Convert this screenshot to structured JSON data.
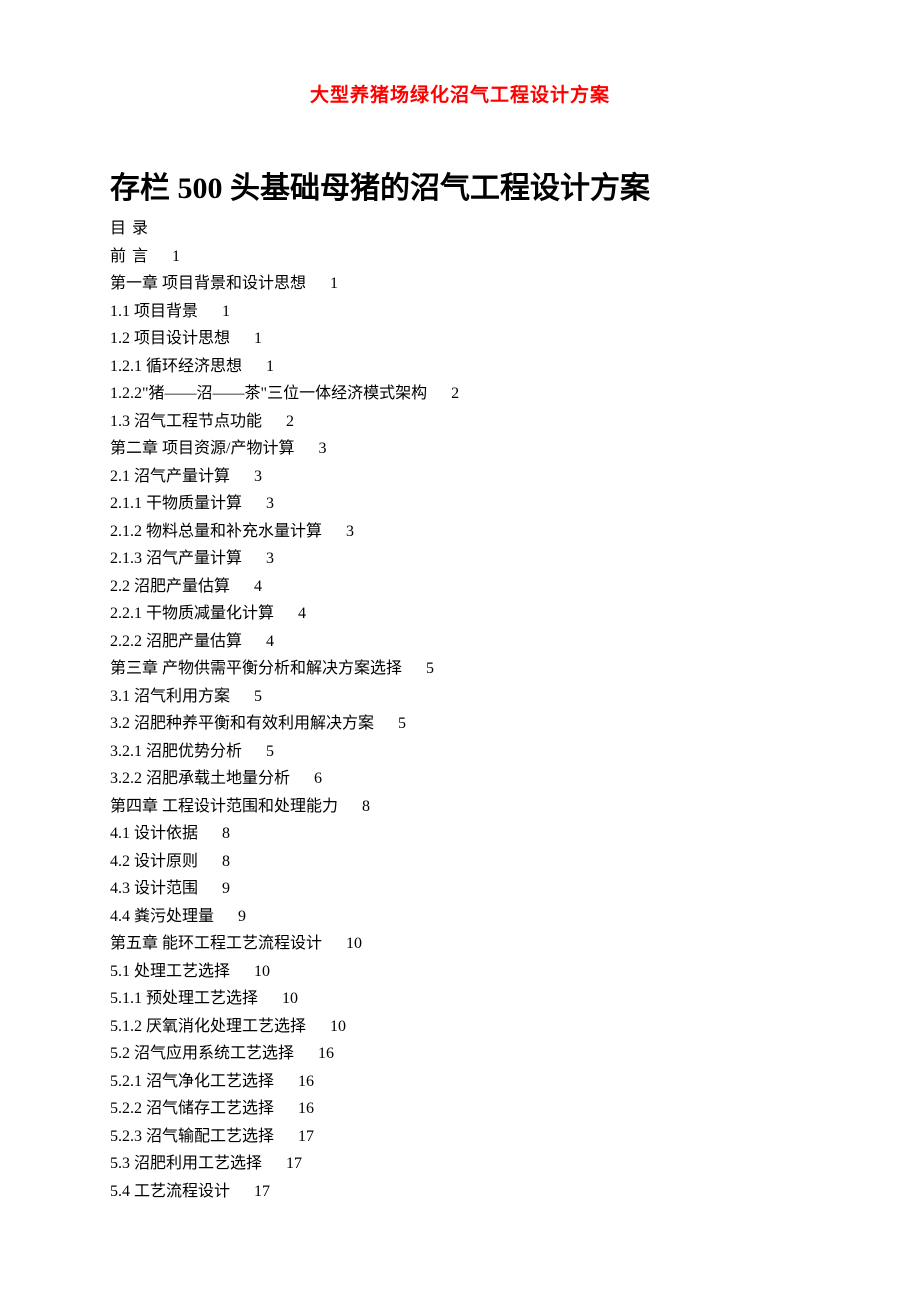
{
  "header_title": "大型养猪场绿化沼气工程设计方案",
  "main_title": "存栏 500 头基础母猪的沼气工程设计方案",
  "toc_header_mu": "目",
  "toc_header_lu": "录",
  "toc": [
    {
      "label_pre": "前",
      "label_post": "言",
      "page": "1",
      "spaced": true
    },
    {
      "label": "第一章 项目背景和设计思想",
      "page": "1"
    },
    {
      "label": "1.1 项目背景",
      "page": "1"
    },
    {
      "label": "1.2 项目设计思想",
      "page": "1"
    },
    {
      "label": "1.2.1 循环经济思想",
      "page": "1"
    },
    {
      "label": "1.2.2\"猪——沼——茶\"三位一体经济模式架构",
      "page": "2"
    },
    {
      "label": "1.3 沼气工程节点功能",
      "page": "2"
    },
    {
      "label": "第二章 项目资源/产物计算",
      "page": "3"
    },
    {
      "label": "2.1 沼气产量计算",
      "page": "3"
    },
    {
      "label": "2.1.1 干物质量计算",
      "page": "3"
    },
    {
      "label": "2.1.2 物料总量和补充水量计算",
      "page": "3"
    },
    {
      "label": "2.1.3 沼气产量计算",
      "page": "3"
    },
    {
      "label": "2.2 沼肥产量估算",
      "page": "4"
    },
    {
      "label": "2.2.1 干物质减量化计算",
      "page": "4"
    },
    {
      "label": "2.2.2 沼肥产量估算",
      "page": "4"
    },
    {
      "label": "第三章 产物供需平衡分析和解决方案选择",
      "page": "5"
    },
    {
      "label": "3.1 沼气利用方案",
      "page": "5"
    },
    {
      "label": "3.2 沼肥种养平衡和有效利用解决方案",
      "page": "5"
    },
    {
      "label": "3.2.1 沼肥优势分析",
      "page": "5"
    },
    {
      "label": "3.2.2 沼肥承载土地量分析",
      "page": "6"
    },
    {
      "label": "第四章 工程设计范围和处理能力",
      "page": "8"
    },
    {
      "label": "4.1 设计依据",
      "page": "8"
    },
    {
      "label": "4.2 设计原则",
      "page": "8"
    },
    {
      "label": "4.3 设计范围",
      "page": "9"
    },
    {
      "label": "4.4 粪污处理量",
      "page": "9"
    },
    {
      "label": "第五章 能环工程工艺流程设计",
      "page": "10"
    },
    {
      "label": "5.1 处理工艺选择",
      "page": "10"
    },
    {
      "label": "5.1.1 预处理工艺选择",
      "page": "10"
    },
    {
      "label": "5.1.2 厌氧消化处理工艺选择",
      "page": "10"
    },
    {
      "label": "5.2 沼气应用系统工艺选择",
      "page": "16"
    },
    {
      "label": "5.2.1 沼气净化工艺选择",
      "page": "16"
    },
    {
      "label": "5.2.2 沼气储存工艺选择",
      "page": "16"
    },
    {
      "label": "5.2.3 沼气输配工艺选择",
      "page": "17"
    },
    {
      "label": "5.3 沼肥利用工艺选择",
      "page": "17"
    },
    {
      "label": "5.4 工艺流程设计",
      "page": "17"
    }
  ]
}
